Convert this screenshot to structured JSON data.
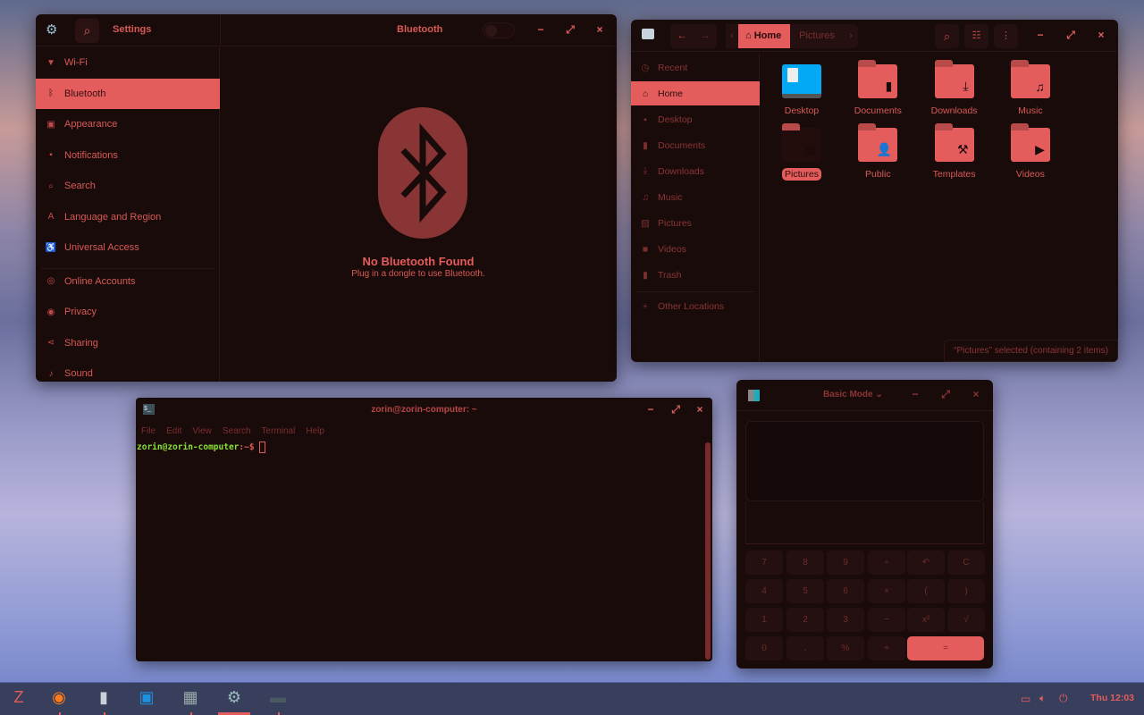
{
  "settings": {
    "title": "Settings",
    "panel_title": "Bluetooth",
    "bluetooth_enabled": false,
    "sidebar": [
      {
        "label": "Wi-Fi",
        "icon": "wifi-icon",
        "g": "▼"
      },
      {
        "label": "Bluetooth",
        "icon": "bluetooth-icon",
        "g": "ᛒ",
        "selected": true
      },
      {
        "label": "Appearance",
        "icon": "appearance-icon",
        "g": "▣"
      },
      {
        "label": "Notifications",
        "icon": "notifications-icon",
        "g": "▪"
      },
      {
        "label": "Search",
        "icon": "search-icon",
        "g": "⌕"
      },
      {
        "label": "Language and Region",
        "icon": "language-icon",
        "g": "A"
      },
      {
        "label": "Universal Access",
        "icon": "accessibility-icon",
        "g": "♿"
      },
      {
        "label": "Online Accounts",
        "icon": "online-accounts-icon",
        "g": "◎"
      },
      {
        "label": "Privacy",
        "icon": "privacy-icon",
        "g": "◉"
      },
      {
        "label": "Sharing",
        "icon": "sharing-icon",
        "g": "⋖"
      },
      {
        "label": "Sound",
        "icon": "sound-icon",
        "g": "♪"
      }
    ],
    "empty_title": "No Bluetooth Found",
    "empty_subtitle": "Plug in a dongle to use Bluetooth."
  },
  "files": {
    "path": [
      "Home",
      "Pictures"
    ],
    "sidebar": [
      {
        "label": "Recent",
        "icon": "clock-icon",
        "g": "◷"
      },
      {
        "label": "Home",
        "icon": "home-icon",
        "g": "⌂",
        "selected": true
      },
      {
        "label": "Desktop",
        "icon": "desktop-icon",
        "g": "▪"
      },
      {
        "label": "Documents",
        "icon": "document-icon",
        "g": "▮"
      },
      {
        "label": "Downloads",
        "icon": "download-icon",
        "g": "⤓"
      },
      {
        "label": "Music",
        "icon": "music-icon",
        "g": "♫"
      },
      {
        "label": "Pictures",
        "icon": "pictures-icon",
        "g": "▨"
      },
      {
        "label": "Videos",
        "icon": "video-icon",
        "g": "■"
      },
      {
        "label": "Trash",
        "icon": "trash-icon",
        "g": "▮"
      }
    ],
    "other_locations": "Other Locations",
    "folders": [
      {
        "label": "Desktop",
        "g": ""
      },
      {
        "label": "Documents",
        "g": "▮"
      },
      {
        "label": "Downloads",
        "g": "⤓"
      },
      {
        "label": "Music",
        "g": "♫"
      },
      {
        "label": "Pictures",
        "g": "▨",
        "selected": true
      },
      {
        "label": "Public",
        "g": "👤"
      },
      {
        "label": "Templates",
        "g": "⚒"
      },
      {
        "label": "Videos",
        "g": "▶"
      }
    ],
    "status": "“Pictures” selected  (containing 2 items)"
  },
  "terminal": {
    "title": "zorin@zorin-computer: ~",
    "menu": [
      "File",
      "Edit",
      "View",
      "Search",
      "Terminal",
      "Help"
    ],
    "prompt_user": "zorin@zorin-computer",
    "prompt_path": ":~$"
  },
  "calculator": {
    "mode": "Basic Mode",
    "keys": [
      "7",
      "8",
      "9",
      "÷",
      "↶",
      "C",
      "4",
      "5",
      "6",
      "×",
      "(",
      ")",
      "1",
      "2",
      "3",
      "−",
      "x²",
      "√",
      "0",
      ".",
      "%",
      "+",
      "="
    ]
  },
  "taskbar": {
    "clock": "Thu 12:03",
    "apps": [
      {
        "name": "zorin-menu-icon"
      },
      {
        "name": "firefox-icon"
      },
      {
        "name": "files-icon"
      },
      {
        "name": "software-store-icon"
      },
      {
        "name": "calculator-icon"
      },
      {
        "name": "settings-icon"
      },
      {
        "name": "terminal-icon"
      }
    ]
  },
  "colors": {
    "accent": "#e45c5c",
    "window_bg": "#1a0b0b",
    "prompt_green": "#8ae234"
  }
}
